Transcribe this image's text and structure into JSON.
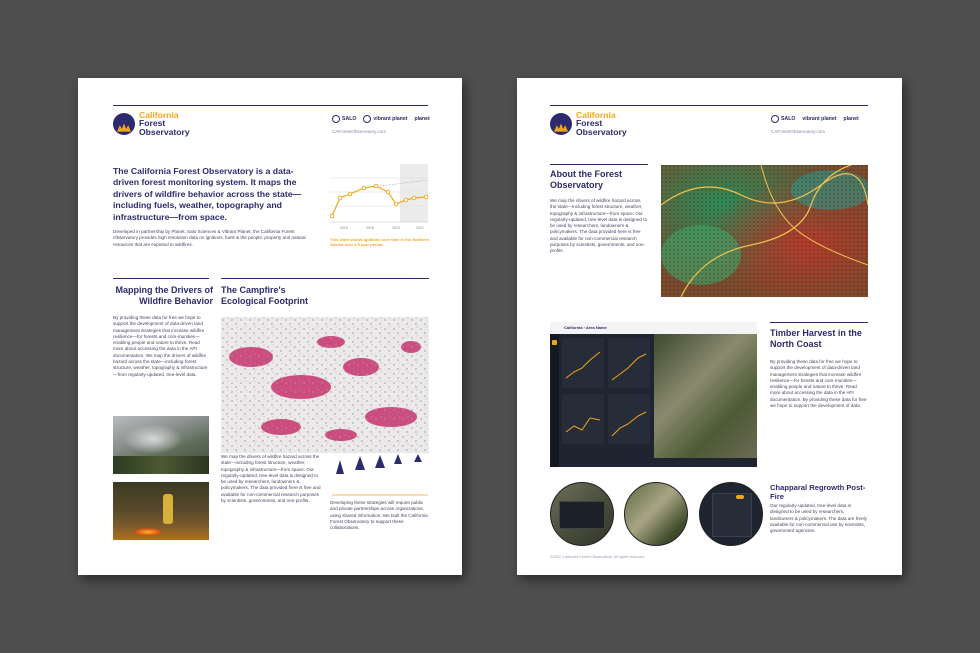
{
  "brand": {
    "name_line1": "California",
    "name_line2": "Forest",
    "name_line3": "Observatory",
    "url": "CAForestObservatory.com",
    "partners": [
      "SALO",
      "vibrant planet",
      "planet"
    ],
    "colors": {
      "navy": "#2d2b6e",
      "gold": "#f2a71b"
    }
  },
  "page1": {
    "headline": "The California Forest Observatory is a data-driven forest monitoring system. It maps the drivers of wildfire behavior across the state— including fuels, weather, topography and infrastructure—from space.",
    "intro": "Developed in partnership by Planet, Salo Sciences & Vibrant Planet, the California Forest Observatory provides high resolution data on ignitions, fuels & the people, property and natural resources that are exposed to wildfires.",
    "chart_caption": "This chart shows ignitions over time in the Northern Sierras over a 5 year period.",
    "chart_ticks": [
      "2016",
      "2018",
      "2019",
      "2021"
    ],
    "section1_title": "Mapping the Drivers of Wildfire Behavior",
    "section1_body": "By providing these data for free we hope to support the development of data-driven land management strategies that increase wildfire resilience—for forests and com-munities—enabling people and nature to thrive. Read more about accessing the data in the API documentation. We map the drivers of wildfire hazard across the state—including forest structure, weather, topography & infrastructure—from regularly-updated, tree-level data.",
    "section2_title": "The Campfire's Ecological Footprint",
    "section2_body": "We map the drivers of wildfire hazard across the state—including forest structure, weather, topography & infrastructure—from space. Our regularly-updated, tree-level data is designed to be used by researchers, landowners & policymakers. The data provided here is free and available for non-commercial research purposes by scientists, governments, and non-profits.",
    "section3_body": "Developing these strategies will require public and private partnerships across organizations, using shared information. We built the California Forest Observatory to support these collaborations."
  },
  "page2": {
    "about_title": "About the Forest Observatory",
    "about_body": "We map the drivers of wildfire hazard across the state—including forest structure, weather, topography & infrastructure—from space. Our regularly-updated, tree-level data is designed to be used by researchers, landowners & policymakers. The data provided here is free and available for non-commercial research purposes by scientists, governments, and non-profits.",
    "timber_title": "Timber Harvest in the North Coast",
    "timber_body": "By providing these data for free we hope to support the development of data-driven land management strategies that increase wildfire resilience—for forests and com-munities—enabling people and nature to thrive. Read more about accessing the data in the API documentation. By providing these data for free we hope to support the development of data.",
    "chaparral_title": "Chapparal Regrowth Post-Fire",
    "chaparral_body": "Our regularly-updated, tree-level data is designed to be used by researchers, landowners & policymakers. The data are freely available for non-commercial use by scientists, government agencies.",
    "dashboard_title": "California › Area Name",
    "footer": "©2022 California Forest Observatory. All rights reserved."
  }
}
